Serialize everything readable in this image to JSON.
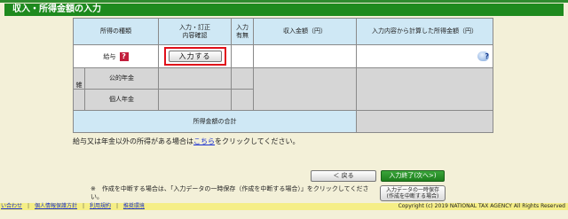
{
  "section_title": "収入・所得金額の入力",
  "headers": {
    "type": "所得の種類",
    "input_confirm": "入力・訂正\n内容確認",
    "input_status": "入力\n有無",
    "income_amount": "収入金額（円）",
    "computed_income": "入力内容から計算した所得金額（円）"
  },
  "rows": {
    "salary_label": "給与",
    "salary_help": "?",
    "input_button": "入力する",
    "salary_help2": "?",
    "misc_label": "雑",
    "public_pension": "公的年金",
    "private_pension": "個人年金",
    "total_label": "所得金額の合計"
  },
  "note": {
    "before": "給与又は年金以外の所得がある場合は",
    "link": "こちら",
    "after": "をクリックしてください。"
  },
  "buttons": {
    "back": "＜ 戻る",
    "next": "入力終了(次へ>)",
    "save_line1": "入力データの一時保存",
    "save_line2": "(作成を中断する場合)"
  },
  "save_note": "※　作成を中断する場合は、「入力データの一時保存（作成を中断する場合）」をクリックしてください。",
  "footer": {
    "links": [
      "い合わせ",
      "個人情報保護方針",
      "利用規約",
      "推奨環境"
    ],
    "copyright": "Copyright (c) 2019 NATIONAL TAX AGENCY All Rights Reserved"
  }
}
